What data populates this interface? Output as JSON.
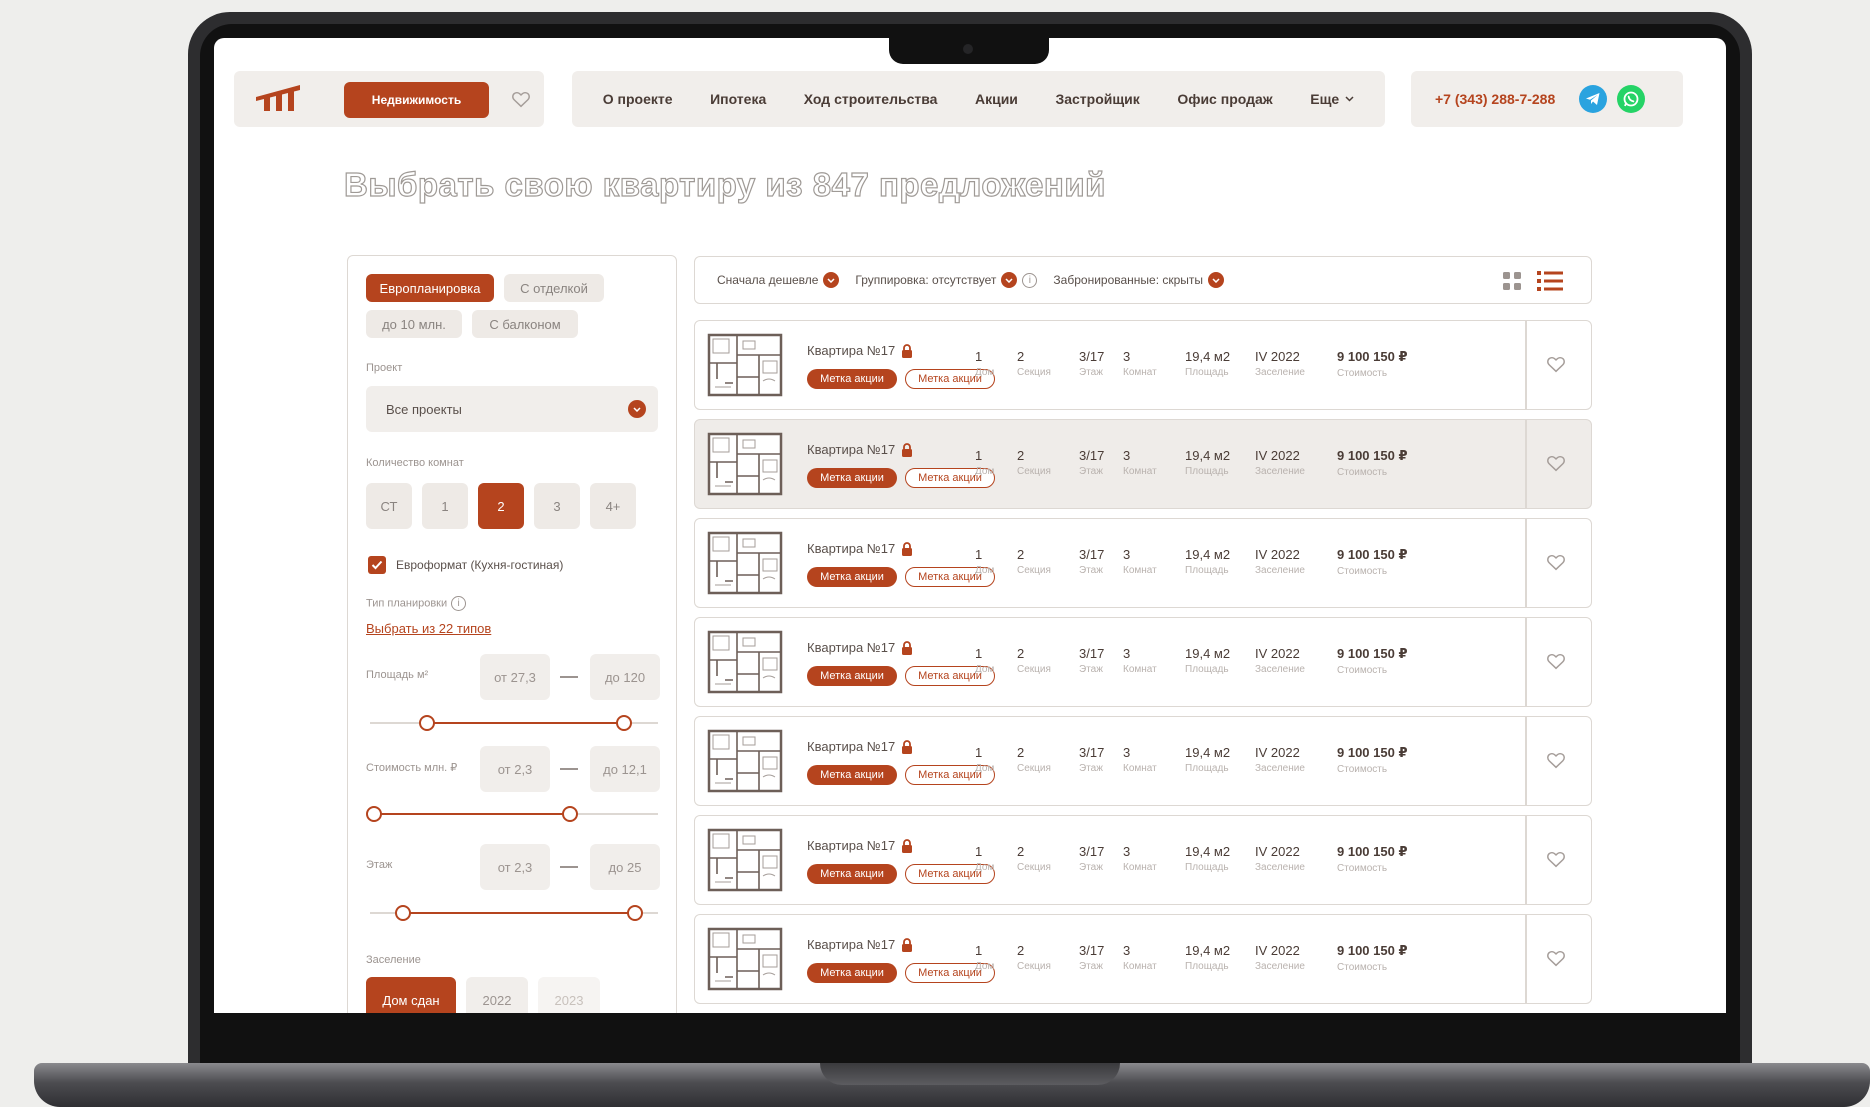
{
  "header": {
    "realty_button": "Недвижимость",
    "nav": [
      "О проекте",
      "Ипотека",
      "Ход строительства",
      "Акции",
      "Застройщик",
      "Офис продаж",
      "Еще"
    ],
    "phone": "+7 (343) 288-7-288"
  },
  "page_title": "Выбрать свою квартиру из 847 предложений",
  "filter": {
    "chips": [
      "Европланировка",
      "С отделкой",
      "до 10 млн.",
      "С балконом"
    ],
    "active_chip": "Европланировка",
    "project_label": "Проект",
    "project_value": "Все проекты",
    "rooms_label": "Количество комнат",
    "rooms": [
      "СТ",
      "1",
      "2",
      "3",
      "4+"
    ],
    "rooms_selected": "2",
    "euro_format_label": "Евроформат (Кухня-гостиная)",
    "euro_format_checked": true,
    "layout_type_label": "Тип планировки",
    "layout_type_link": "Выбрать из 22 типов",
    "area": {
      "label": "Площадь м²",
      "from": "от  27,3",
      "to": "до  120"
    },
    "price": {
      "label": "Стоимость млн. ₽",
      "from": "от  2,3",
      "to": "до  12,1"
    },
    "floor": {
      "label": "Этаж",
      "from": "от  2,3",
      "to": "до  25"
    },
    "settlement_label": "Заселение",
    "settlement_options": [
      "Дом сдан",
      "2022",
      "2023"
    ],
    "settlement_selected": "Дом сдан"
  },
  "toolbar": {
    "sort": "Сначала дешевле",
    "grouping": "Группировка:  отсутствует",
    "reserved": "Забронированные:  скрыты"
  },
  "cards": [
    {
      "name": "Квартира №17",
      "tags": [
        "Метка акции",
        "Метка акции"
      ],
      "house": "1",
      "section": "2",
      "floor": "3/17",
      "rooms": "3",
      "area": "19,4 м2",
      "settle": "IV 2022",
      "price": "9 100 150 ₽"
    },
    {
      "name": "Квартира №17",
      "tags": [
        "Метка акции",
        "Метка акции"
      ],
      "house": "1",
      "section": "2",
      "floor": "3/17",
      "rooms": "3",
      "area": "19,4 м2",
      "settle": "IV 2022",
      "price": "9 100 150 ₽"
    },
    {
      "name": "Квартира №17",
      "tags": [
        "Метка акции",
        "Метка акции"
      ],
      "house": "1",
      "section": "2",
      "floor": "3/17",
      "rooms": "3",
      "area": "19,4 м2",
      "settle": "IV 2022",
      "price": "9 100 150 ₽"
    },
    {
      "name": "Квартира №17",
      "tags": [
        "Метка акции",
        "Метка акции"
      ],
      "house": "1",
      "section": "2",
      "floor": "3/17",
      "rooms": "3",
      "area": "19,4 м2",
      "settle": "IV 2022",
      "price": "9 100 150 ₽"
    },
    {
      "name": "Квартира №17",
      "tags": [
        "Метка акции",
        "Метка акции"
      ],
      "house": "1",
      "section": "2",
      "floor": "3/17",
      "rooms": "3",
      "area": "19,4 м2",
      "settle": "IV 2022",
      "price": "9 100 150 ₽"
    },
    {
      "name": "Квартира №17",
      "tags": [
        "Метка акции",
        "Метка акции"
      ],
      "house": "1",
      "section": "2",
      "floor": "3/17",
      "rooms": "3",
      "area": "19,4 м2",
      "settle": "IV 2022",
      "price": "9 100 150 ₽"
    },
    {
      "name": "Квартира №17",
      "tags": [
        "Метка акции",
        "Метка акции"
      ],
      "house": "1",
      "section": "2",
      "floor": "3/17",
      "rooms": "3",
      "area": "19,4 м2",
      "settle": "IV 2022",
      "price": "9 100 150 ₽"
    }
  ],
  "card_labels": {
    "house": "Дом",
    "section": "Секция",
    "floor": "Этаж",
    "rooms": "Комнат",
    "area": "Площадь",
    "settle": "Заселение",
    "price": "Стоимость"
  },
  "colors": {
    "accent": "#b5441e",
    "panel_bg": "#f1eeeb",
    "border": "#ddd8d3"
  }
}
